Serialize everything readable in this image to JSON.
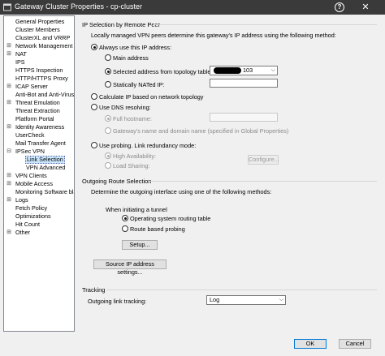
{
  "window": {
    "title": "Gateway Cluster Properties - cp-cluster",
    "help_icon": "question-mark-icon",
    "close_icon": "close-x-icon"
  },
  "tree": {
    "items": [
      {
        "label": "General Properties",
        "expander": ""
      },
      {
        "label": "Cluster Members",
        "expander": ""
      },
      {
        "label": "ClusterXL and VRRP",
        "expander": ""
      },
      {
        "label": "Network Management",
        "expander": "⊞"
      },
      {
        "label": "NAT",
        "expander": "⊞"
      },
      {
        "label": "IPS",
        "expander": ""
      },
      {
        "label": "HTTPS Inspection",
        "expander": ""
      },
      {
        "label": "HTTP/HTTPS Proxy",
        "expander": ""
      },
      {
        "label": "ICAP Server",
        "expander": "⊞"
      },
      {
        "label": "Anti-Bot and Anti-Virus",
        "expander": ""
      },
      {
        "label": "Threat Emulation",
        "expander": "⊞"
      },
      {
        "label": "Threat Extraction",
        "expander": ""
      },
      {
        "label": "Platform Portal",
        "expander": ""
      },
      {
        "label": "Identity Awareness",
        "expander": "⊞"
      },
      {
        "label": "UserCheck",
        "expander": ""
      },
      {
        "label": "Mail Transfer Agent",
        "expander": ""
      },
      {
        "label": "IPSec VPN",
        "expander": "⊟"
      },
      {
        "label": "Link Selection",
        "expander": ""
      },
      {
        "label": "VPN Advanced",
        "expander": ""
      },
      {
        "label": "VPN Clients",
        "expander": "⊞"
      },
      {
        "label": "Mobile Access",
        "expander": "⊞"
      },
      {
        "label": "Monitoring Software bla",
        "expander": ""
      },
      {
        "label": "Logs",
        "expander": "⊞"
      },
      {
        "label": "Fetch Policy",
        "expander": ""
      },
      {
        "label": "Optimizations",
        "expander": ""
      },
      {
        "label": "Hit Count",
        "expander": ""
      },
      {
        "label": "Other",
        "expander": "⊞"
      }
    ]
  },
  "ip_selection": {
    "group_title": "IP Selection by Remote Peer",
    "description": "Locally managed VPN peers determine this gateway's IP address using the following method:",
    "always_use_label": "Always use this IP address:",
    "main_address_label": "Main address",
    "selected_address_label": "Selected address from topology table:",
    "selected_address_value": "103",
    "statically_nated_label": "Statically NATed IP:",
    "statically_nated_value": "",
    "calculate_label": "Calculate IP based on network topology",
    "dns_label": "Use DNS resolving:",
    "full_hostname_label": "Full hostname:",
    "full_hostname_value": "",
    "gateway_name_label": "Gateway's name and domain name (specified in Global Properties)",
    "probing_label": "Use probing. Link redundancy mode:",
    "high_availability_label": "High Availability:",
    "load_sharing_label": "Load Sharing:",
    "configure_button": "Configure..."
  },
  "outgoing_route": {
    "group_title": "Outgoing Route Selection",
    "description": "Determine the outgoing interface using one of the following methods:",
    "when_initiating_label": "When initiating a tunnel",
    "os_routing_label": "Operating system routing table",
    "route_probing_label": "Route based probing",
    "setup_button": "Setup...",
    "source_ip_button": "Source IP address settings..."
  },
  "tracking": {
    "group_title": "Tracking",
    "outgoing_link_label": "Outgoing link tracking:",
    "outgoing_link_value": "Log"
  },
  "footer": {
    "ok_label": "OK",
    "cancel_label": "Cancel"
  },
  "colors": {
    "titlebar": "#3a3a3a",
    "selection": "#cce8ff",
    "primary_border": "#0078d7"
  }
}
